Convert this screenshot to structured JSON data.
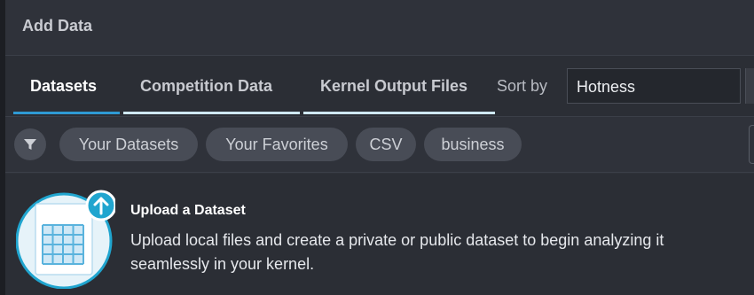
{
  "dialog": {
    "title": "Add Data"
  },
  "tabs": [
    {
      "label": "Datasets",
      "active": true
    },
    {
      "label": "Competition Data",
      "active": false
    },
    {
      "label": "Kernel Output Files",
      "active": false
    }
  ],
  "sort": {
    "label": "Sort by",
    "value": "Hotness"
  },
  "filters": {
    "icon": "filter-icon",
    "chips": [
      "Your Datasets",
      "Your Favorites",
      "CSV",
      "business"
    ]
  },
  "upload": {
    "title": "Upload a Dataset",
    "description": "Upload local files and create a private or public dataset to begin analyzing it seamlessly in your kernel.",
    "icon": "upload-arrow-icon"
  },
  "colors": {
    "accent": "#2f9ad4",
    "upload_badge": "#20a5cf",
    "chip_bg": "#484c56",
    "panel_bg": "#2f323a"
  }
}
